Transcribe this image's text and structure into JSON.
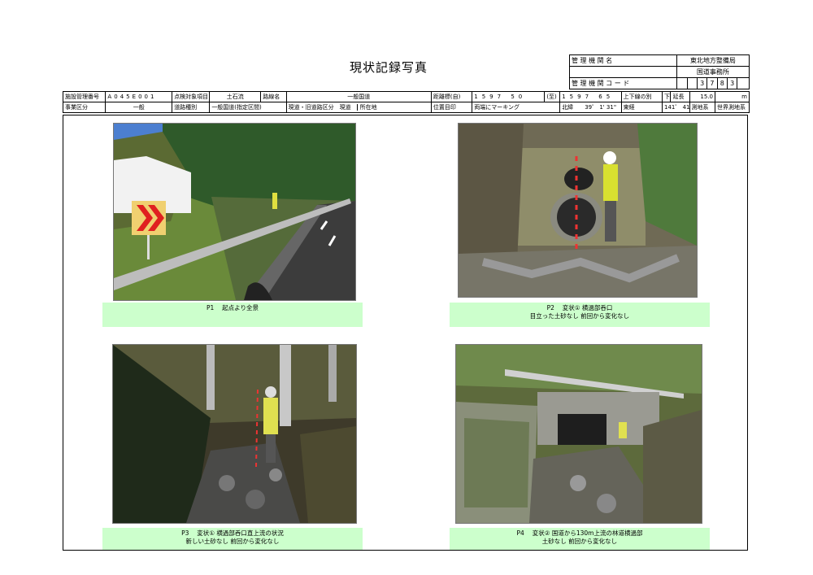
{
  "title": "現状記録写真",
  "management": {
    "org_label": "管 理 機 関 名",
    "org_name1": "東北地方整備局",
    "org_name2": "国道事務所",
    "code_label": "管 理 機 関 コ ー ド",
    "code_digits": [
      "",
      "",
      "3",
      "7",
      "8",
      "3",
      ""
    ]
  },
  "info_row1": {
    "facility_no_label": "施設管理番号",
    "facility_no_chars": [
      "A",
      "0",
      "4",
      "5",
      "E",
      "0",
      "0",
      "1"
    ],
    "inspection_label": "点検対象項目",
    "inspection_value": "土石流",
    "route_label": "路線名",
    "route_value": "一般国道",
    "distance_from_label": "距離標(自)",
    "distance_from_digits": [
      "1",
      "5",
      "9",
      "7",
      "5",
      "0"
    ],
    "to_label": "(至)",
    "distance_to_digits": [
      "1",
      "5",
      "9",
      "7",
      "6",
      "5"
    ],
    "updown_label": "上下線の別",
    "updown_value": "下",
    "length_label": "延長",
    "length_value": "15.0",
    "length_unit": "m"
  },
  "info_row2": {
    "business_label": "事業区分",
    "business_value": "一般",
    "road_type_label": "道路種別",
    "road_type_value": "一般国道(指定区間)",
    "section_label": "現道・旧道路区分",
    "section_value": "現道",
    "location_label": "所在地",
    "location_value": "",
    "position_label": "位置目印",
    "position_value": "両端にマーキング",
    "lat_label": "北緯",
    "lat_value": "39゜ 1' 31\"",
    "lon_label": "東経",
    "lon_value": "141゜ 41' 5\"",
    "geodetic_label": "測地系",
    "geodetic_value": "世界測地系"
  },
  "photos": [
    {
      "line1": "P1　 起点より全景",
      "line2": ""
    },
    {
      "line1": "P2　 変状① 横過部呑口",
      "line2": "目立った土砂なし 前回から変化なし"
    },
    {
      "line1": "P3　 変状① 横過部呑口直上流の状況",
      "line2": "新しい土砂なし 前回から変化なし"
    },
    {
      "line1": "P4　 変状② 国道から130m上流の林道横過部",
      "line2": "土砂なし 前回から変化なし"
    }
  ]
}
